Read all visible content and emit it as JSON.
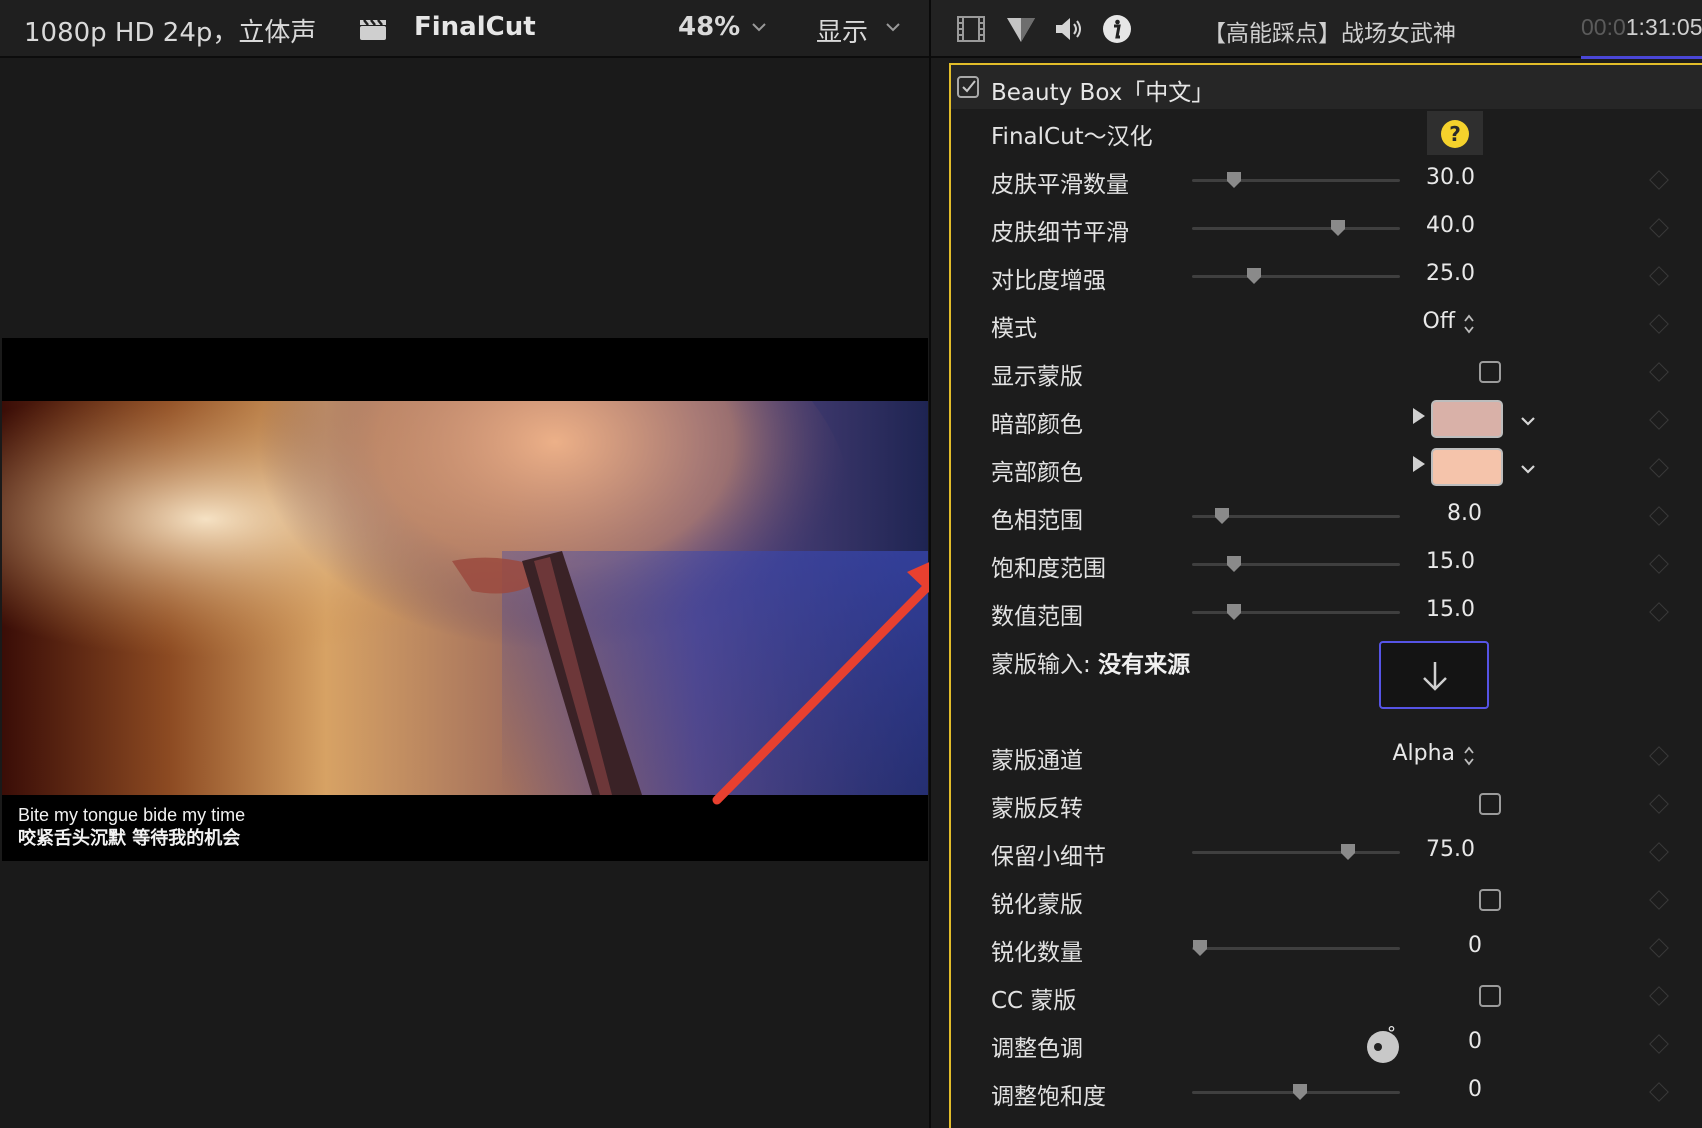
{
  "viewer": {
    "format": "1080p HD 24p，立体声",
    "project": "FinalCut",
    "zoom": "48%",
    "display_menu": "显示",
    "subtitle_en": "Bite my tongue bide my time",
    "subtitle_zh": "咬紧舌头沉默 等待我的机会"
  },
  "inspector": {
    "clip_title": "【高能踩点】战场女武神",
    "timecode_dim": "00:0",
    "timecode": "1:31:05",
    "effect_name": "Beauty Box「中文」",
    "effect_enabled": true,
    "brand_label": "FinalCut～汉化",
    "help_icon": "?",
    "params": {
      "skin_smoothing": {
        "label": "皮肤平滑数量",
        "value": "30.0",
        "level": 0.17
      },
      "skin_detail": {
        "label": "皮肤细节平滑",
        "value": "40.0",
        "level": 0.69
      },
      "contrast": {
        "label": "对比度增强",
        "value": "25.0",
        "level": 0.27
      },
      "mode": {
        "label": "模式",
        "value": "Off"
      },
      "show_mask": {
        "label": "显示蒙版",
        "checked": false
      },
      "dark_color": {
        "label": "暗部颜色",
        "color": "#d9b1a8"
      },
      "light_color": {
        "label": "亮部颜色",
        "color": "#f5c4ab"
      },
      "hue_range": {
        "label": "色相范围",
        "value": "8.0",
        "level": 0.11
      },
      "sat_range": {
        "label": "饱和度范围",
        "value": "15.0",
        "level": 0.17
      },
      "value_range": {
        "label": "数值范围",
        "value": "15.0",
        "level": 0.17
      },
      "mask_input_label": "蒙版输入:",
      "mask_input_source": "没有来源",
      "mask_channel": {
        "label": "蒙版通道",
        "value": "Alpha"
      },
      "mask_invert": {
        "label": "蒙版反转",
        "checked": false
      },
      "keep_detail": {
        "label": "保留小细节",
        "value": "75.0",
        "level": 0.74
      },
      "sharpen_mask": {
        "label": "锐化蒙版",
        "checked": false
      },
      "sharpen_amount": {
        "label": "锐化数量",
        "value": "0",
        "level": 0.0
      },
      "cc_mask": {
        "label": "CC 蒙版",
        "checked": false
      },
      "adjust_hue": {
        "label": "调整色调",
        "value": "0",
        "unit": "°"
      },
      "adjust_sat": {
        "label": "调整饱和度",
        "value": "0",
        "level": 0.5
      }
    }
  },
  "colors": {
    "accent_yellow": "#e2bd2a",
    "accent_blue": "#5654e6",
    "arrow_red": "#e8402f"
  },
  "icons": [
    "clapper-icon",
    "chevron-down-icon",
    "film-icon",
    "filter-icon",
    "speaker-icon",
    "info-icon",
    "help-icon",
    "keyframe-icon",
    "down-arrow-icon",
    "stepper-icon"
  ]
}
